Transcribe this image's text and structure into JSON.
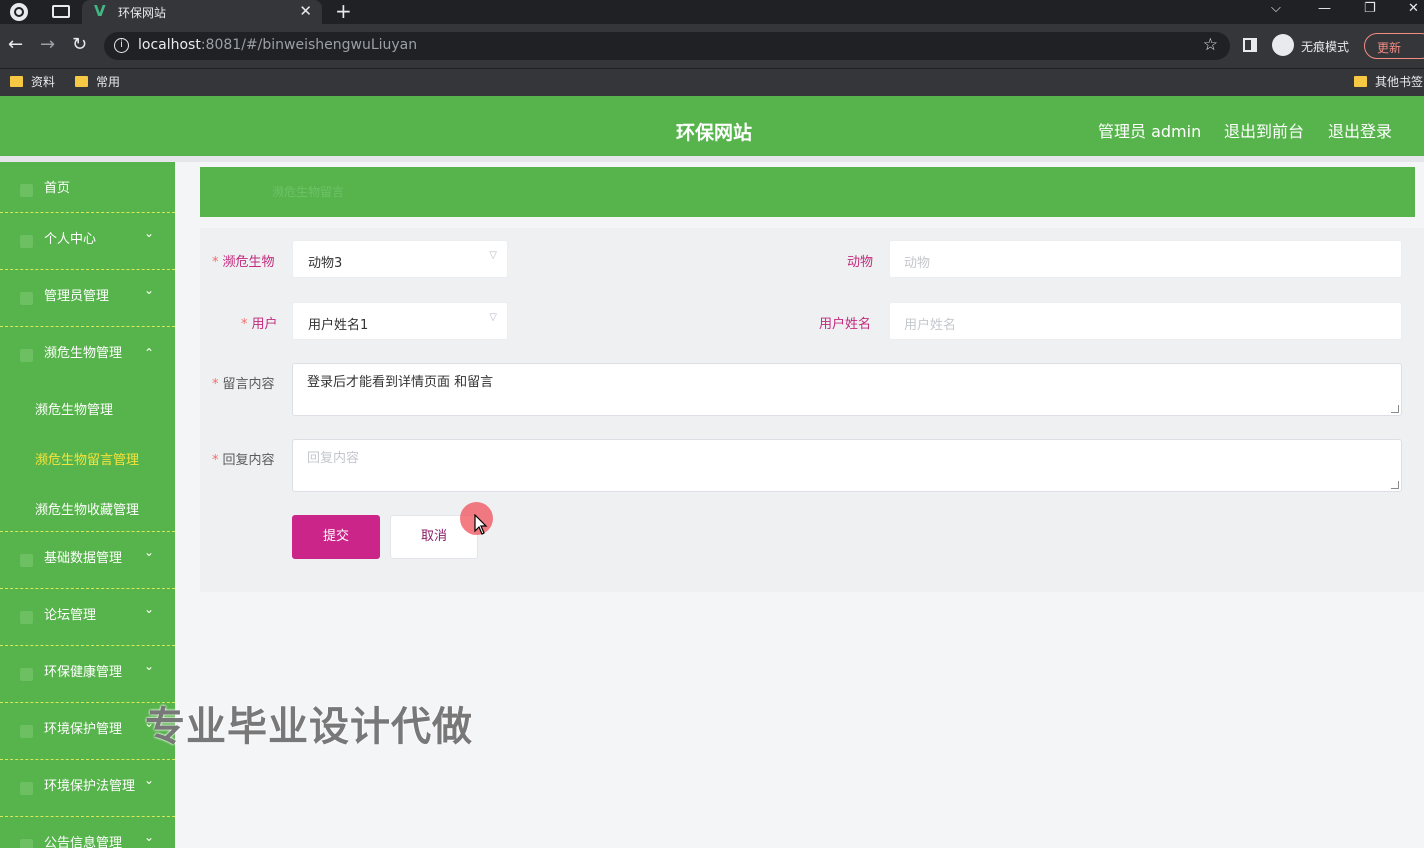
{
  "browser": {
    "tab_title": "环保网站",
    "tab_logo": "V",
    "url_host": "localhost",
    "url_rest": ":8081/#/binweishengwuLiuyan",
    "incognito_label": "无痕模式",
    "update_label": "更新",
    "bookmarks": [
      "资料",
      "常用"
    ],
    "other_bookmarks": "其他书签"
  },
  "header": {
    "title": "环保网站",
    "admin_label": "管理员 admin",
    "front_link": "退出到前台",
    "logout_link": "退出登录",
    "accent_color": "#57b44c"
  },
  "sidebar": {
    "items": [
      {
        "label": "首页",
        "arrow": ""
      },
      {
        "label": "个人中心",
        "arrow": "⌄"
      },
      {
        "label": "管理员管理",
        "arrow": "⌄"
      },
      {
        "label": "濒危生物管理",
        "arrow": "⌃"
      }
    ],
    "sub_items": [
      {
        "label": "濒危生物管理"
      },
      {
        "label": "濒危生物留言管理"
      },
      {
        "label": "濒危生物收藏管理"
      }
    ],
    "items_after": [
      {
        "label": "基础数据管理",
        "arrow": "⌄"
      },
      {
        "label": "论坛管理",
        "arrow": "⌄"
      },
      {
        "label": "环保健康管理",
        "arrow": "⌄"
      },
      {
        "label": "环境保护管理",
        "arrow": "⌄"
      },
      {
        "label": "环境保护法管理",
        "arrow": "⌄"
      },
      {
        "label": "公告信息管理",
        "arrow": "⌄"
      }
    ]
  },
  "breadcrumb": "濒危生物留言",
  "form": {
    "species_label": "濒危生物",
    "species_value": "动物3",
    "animal_label": "动物",
    "animal_placeholder": "动物",
    "user_label": "用户",
    "user_value": "用户姓名1",
    "username_label": "用户姓名",
    "username_placeholder": "用户姓名",
    "message_label": "留言内容",
    "message_value": "登录后才能看到详情页面  和留言",
    "reply_label": "回复内容",
    "reply_placeholder": "回复内容",
    "submit_label": "提交",
    "cancel_label": "取消"
  },
  "watermark": "专业毕业设计代做",
  "colors": {
    "primary": "#57b44c",
    "submit": "#cc2589",
    "label": "#c22a7d",
    "active_menu": "#f6e33c"
  }
}
